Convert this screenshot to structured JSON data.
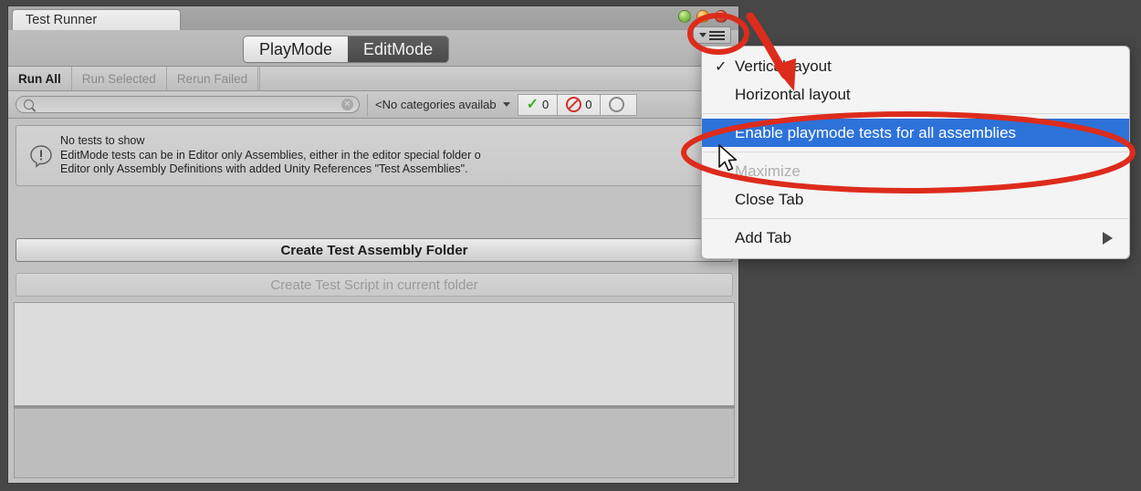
{
  "window": {
    "tab_title": "Test Runner",
    "window_buttons": [
      "minimize-dot",
      "maximize-dot",
      "close-dot"
    ],
    "options_button_icon": "hamburger-menu-icon"
  },
  "mode_toggle": {
    "options": [
      "PlayMode",
      "EditMode"
    ],
    "selected": "EditMode"
  },
  "run_toolbar": {
    "buttons": [
      {
        "label": "Run All",
        "enabled": true
      },
      {
        "label": "Run Selected",
        "enabled": false
      },
      {
        "label": "Rerun Failed",
        "enabled": false
      }
    ]
  },
  "filter_bar": {
    "search_value": "",
    "search_placeholder": "",
    "search_icon": "search-icon",
    "clear_icon": "clear-icon",
    "category_dropdown": "<No categories availab",
    "counters": [
      {
        "icon": "check-icon",
        "value": "0",
        "color": "#3cb521"
      },
      {
        "icon": "blocked-icon",
        "value": "0",
        "color": "#d0332b"
      },
      {
        "icon": "info-icon",
        "value": "",
        "color": "#8a8a8a"
      }
    ]
  },
  "help_box": {
    "icon": "warning-icon",
    "line1": "No tests to show",
    "line2": "EditMode tests can be in Editor only Assemblies, either in the editor special folder o",
    "line3": "Editor only Assembly Definitions with added Unity References \"Test Assemblies\"."
  },
  "actions": {
    "create_assembly_folder": "Create Test Assembly Folder",
    "create_test_script": "Create Test Script in current folder"
  },
  "context_menu": {
    "items": [
      {
        "label": "Vertical layout",
        "checked": true,
        "state": "normal"
      },
      {
        "label": "Horizontal layout",
        "checked": false,
        "state": "normal"
      },
      {
        "separator_after": true
      },
      {
        "label": "Enable playmode tests for all assemblies",
        "checked": false,
        "state": "selected"
      },
      {
        "separator_after": true
      },
      {
        "label": "Maximize",
        "checked": false,
        "state": "disabled"
      },
      {
        "label": "Close Tab",
        "checked": false,
        "state": "normal"
      },
      {
        "separator_after": true
      },
      {
        "label": "Add Tab",
        "checked": false,
        "state": "normal",
        "submenu": true
      }
    ],
    "check_glyph": "✓"
  },
  "annotations": {
    "highlight_color": "#dd2b1c",
    "ellipse_menu_item": "emphasis-ellipse-around-enable-playmode-tests",
    "ellipse_options_button": "emphasis-ellipse-around-options-button",
    "arrow": "emphasis-arrow-pointing-to-menu"
  },
  "colors": {
    "selection_blue": "#2d72d9",
    "desktop_background": "#474747",
    "panel_background": "#c2c2c2"
  }
}
